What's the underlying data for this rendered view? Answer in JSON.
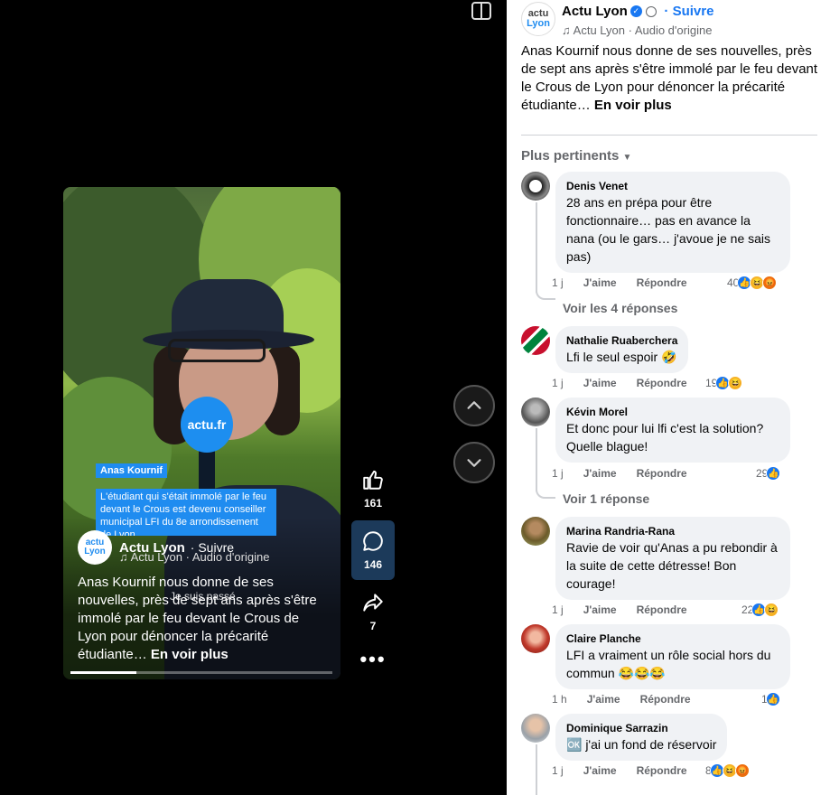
{
  "video": {
    "caption_name": "Anas Kournif",
    "caption_line": "L'étudiant qui s'était immolé par le feu devant le Crous est devenu conseiller municipal LFI du 8e arrondissement de Lyon",
    "subtitle": "Je suis passé",
    "mic_label": "actu.fr",
    "author": "Actu Lyon",
    "follow": "Suivre",
    "audio": "Actu Lyon · Audio d'origine",
    "description": "Anas Kournif nous donne de ses nouvelles, près de sept ans après s'être immolé par le feu devant le Crous de Lyon pour dénoncer la précarité étudiante…",
    "see_more": "En voir plus",
    "progress_fraction": 0.25
  },
  "actions": {
    "likes": "161",
    "comments": "146",
    "shares": "7"
  },
  "header": {
    "logo_line1": "actu",
    "logo_line2": "Lyon",
    "name": "Actu Lyon",
    "follow": "Suivre",
    "audio": "Actu Lyon · Audio d'origine"
  },
  "post": {
    "description": "Anas Kournif nous donne de ses nouvelles, près de sept ans après s'être immolé par le feu devant le Crous de Lyon pour dénoncer la précarité étudiante…",
    "see_more": "En voir plus"
  },
  "sort_label": "Plus pertinents",
  "labels": {
    "like": "J'aime",
    "reply": "Répondre"
  },
  "comments": [
    {
      "name": "Denis Venet",
      "text": "28 ans en prépa pour être fonctionnaire… pas en avance la nana (ou le gars… j'avoue je ne sais pas)",
      "time": "1 j",
      "count": "40",
      "replies": "Voir les 4 réponses"
    },
    {
      "name": "Nathalie Ruaberchera",
      "text": "Lfi le seul espoir 🤣",
      "time": "1 j",
      "count": "19",
      "replies": ""
    },
    {
      "name": "Kévin Morel",
      "text": "Et donc pour lui lfi c'est la solution? Quelle blague!",
      "time": "1 j",
      "count": "29",
      "replies": "Voir 1 réponse"
    },
    {
      "name": "Marina Randria-Rana",
      "text": "Ravie de voir qu'Anas a pu rebondir à la suite de cette détresse! Bon courage!",
      "time": "1 j",
      "count": "22",
      "replies": ""
    },
    {
      "name": "Claire Planche",
      "text": "LFI a vraiment un rôle social hors du commun 😂😂😂",
      "time": "1 h",
      "count": "1",
      "replies": ""
    },
    {
      "name": "Dominique Sarrazin",
      "text": "🆗 j'ai un fond de réservoir",
      "time": "1 j",
      "count": "8",
      "replies": ""
    }
  ],
  "colors": {
    "accent": "#1877f2",
    "brand": "#1f8cf0"
  }
}
